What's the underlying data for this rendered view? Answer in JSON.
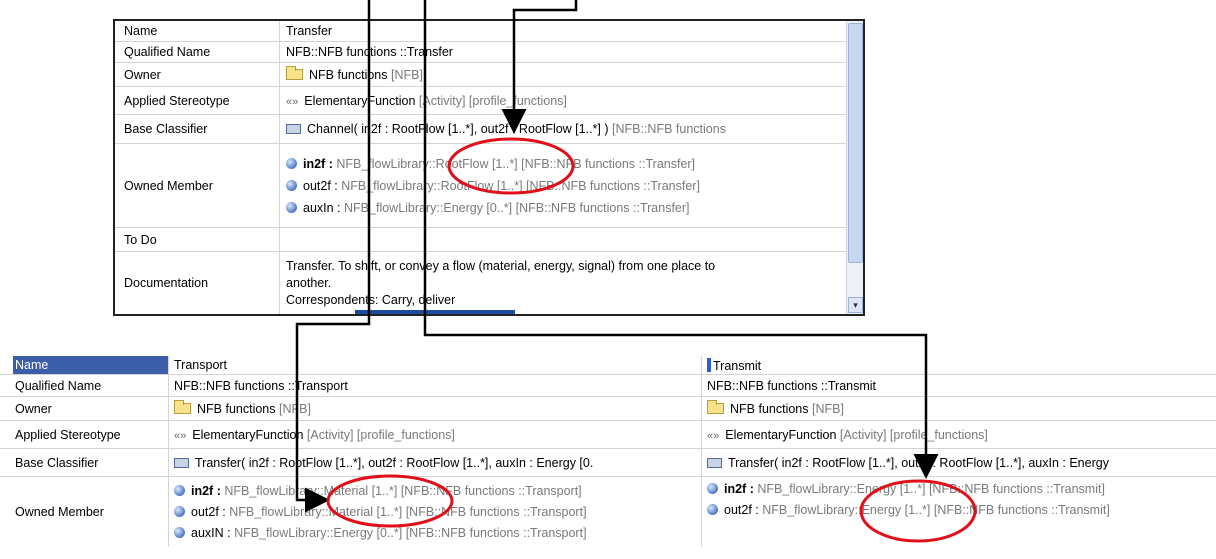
{
  "colors": {
    "arrow": "#000000",
    "highlight_circle": "#e0101a",
    "name_header": "#3c5ea8"
  },
  "top_table": {
    "rows": [
      {
        "label": "Name",
        "value": "Transfer"
      },
      {
        "label": "Qualified Name",
        "value_a": "NFB::NFB f",
        "value_b": "unctions ::Transfer"
      },
      {
        "label": "Owner",
        "value": "NFB functions",
        "value_grey": "[NFB]"
      },
      {
        "label": "Applied Stereotype",
        "value": "ElementaryFunction",
        "value_grey": "[Activity] [profile_functions]"
      },
      {
        "label": "Base Classifier",
        "value": "Channel( in2f : RootFlow [1..*], out2f : RootFlow [1..*] )",
        "value_grey": "[NFB::NFB functions"
      },
      {
        "label": "Owned Member",
        "members": [
          {
            "name": "in2f :",
            "type": "NFB_flowLibrary::RootFlow [1..*]",
            "path": "[NFB::NFB functions ::Transfer]"
          },
          {
            "name": "out2f :",
            "type": "NFB_flowLibrary::RootFlow [1..*]",
            "path": "[NFB::NFB functions ::Transfer]"
          },
          {
            "name": "auxIn :",
            "type": "NFB_flowLibrary::Energy [0..*]",
            "path": "[NFB::NFB functions ::Transfer]"
          }
        ]
      },
      {
        "label": "To Do",
        "value": ""
      },
      {
        "label": "Documentation",
        "doc": [
          "Transfer. To shift, or convey a flow (material, energy, signal) from one place to",
          "another.",
          "Correspondents: Carry, deliver"
        ]
      }
    ],
    "scroll_down": "▾"
  },
  "bottom_labels": [
    "Name",
    "Qualified Name",
    "Owner",
    "Applied Stereotype",
    "Base Classifier",
    "Owned Member"
  ],
  "transport": {
    "name": "Transport",
    "qualified": "NFB::NFB functions ::Transport",
    "owner": "NFB functions",
    "owner_grey": "[NFB]",
    "stereotype": "ElementaryFunction",
    "stereotype_grey": "[Activity] [profile_functions]",
    "base": "Transfer( in2f : RootFlow [1..*], out2f : RootFlow [1..*], auxIn : Energy [0.",
    "members": [
      {
        "name": "in2f :",
        "type": "NFB_flowLibrary::Material [1..*]",
        "path": "[NFB::NFB functions ::Transport]"
      },
      {
        "name": "out2f :",
        "type": "NFB_flowLibrary::Material [1..*]",
        "path": "[NFB::NFB functions ::Transport]"
      },
      {
        "name": "auxIN :",
        "type": "NFB_flowLibrary::Energy [0..*]",
        "path": "[NFB::NFB functions ::Transport]"
      }
    ]
  },
  "transmit": {
    "name": "Transmit",
    "qualified": "NFB::NFB functions ::Transmit",
    "owner": "NFB functions",
    "owner_grey": "[NFB]",
    "stereotype": "ElementaryFunction",
    "stereotype_grey": "[Activity] [profile_functions]",
    "base": "Transfer( in2f : RootFlow [1..*], out2f : RootFlow [1..*], auxIn : Energy",
    "members": [
      {
        "name": "in2f :",
        "type": "NFB_flowLibrary::Energy [1..*]",
        "path": "[NFB::NFB functions ::Transmit]"
      },
      {
        "name": "out2f :",
        "type": "NFB_flowLibrary::Energy [1..*]",
        "path": "[NFB::NFB functions ::Transmit]"
      }
    ]
  },
  "icons": {
    "owner": "folder-icon",
    "stereotype": "stereotype-icon",
    "classifier": "class-icon",
    "member": "property-icon"
  },
  "stereotype_glyph": "«»"
}
